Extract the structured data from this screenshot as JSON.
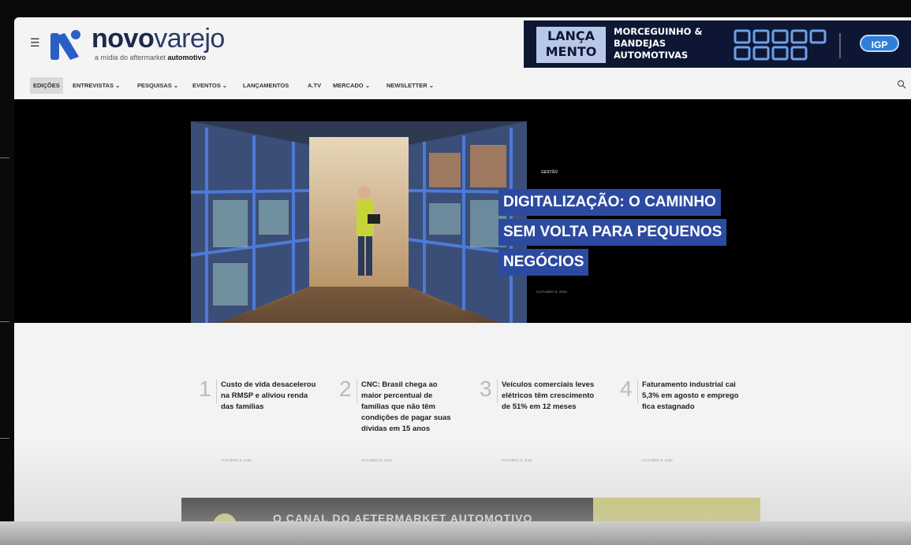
{
  "header": {
    "logo_bold": "novo",
    "logo_light": "varejo",
    "tagline_prefix": "a mídia do aftermarket ",
    "tagline_bold": "automotivo"
  },
  "banner": {
    "lanca_line1": "LANÇA",
    "lanca_line2": "MENTO",
    "text_line1": "MORCEGUINHO &",
    "text_line2": "BANDEJAS",
    "text_line3": "AUTOMOTIVAS",
    "brand": "IGP"
  },
  "nav": {
    "items": [
      "EDIÇÕES",
      "ENTREVISTAS ⌄",
      "PESQUISAS ⌄",
      "EVENTOS ⌄",
      "LANÇAMENTOS",
      "A.TV",
      "MERCADO ⌄",
      "NEWSLETTER ⌄"
    ]
  },
  "hero": {
    "kicker": "GESTÃO",
    "headline_lines": [
      "DIGITALIZAÇÃO: O CAMINHO",
      "SEM VOLTA PARA PEQUENOS",
      "NEGÓCIOS"
    ],
    "date": "OUTUBRO 8, 2025"
  },
  "stories": [
    {
      "num": "1",
      "title": "Custo de vida desacelerou na RMSP e aliviou renda das famílias",
      "date": "OUTUBRO 8, 2025"
    },
    {
      "num": "2",
      "title": "CNC: Brasil chega ao maior percentual de famílias que não têm condições de pagar suas dívidas em 15 anos",
      "date": "OUTUBRO 8, 2025"
    },
    {
      "num": "3",
      "title": "Veículos comerciais leves elétricos têm crescimento de 51% em 12 meses",
      "date": "OUTUBRO 8, 2025"
    },
    {
      "num": "4",
      "title": "Faturamento industrial cai 5,3% em agosto e emprego fica estagnado",
      "date": "OUTUBRO 8, 2025"
    }
  ],
  "ad": {
    "text": "O CANAL DO AFTERMARKET AUTOMOTIVO"
  },
  "colors": {
    "brand_navy": "#1b2a4a",
    "logo_blue": "#2b5fc6",
    "headline_bg": "#2c4aa0",
    "banner_bg": "#0d1733",
    "ad_yellow": "#c8c457"
  }
}
